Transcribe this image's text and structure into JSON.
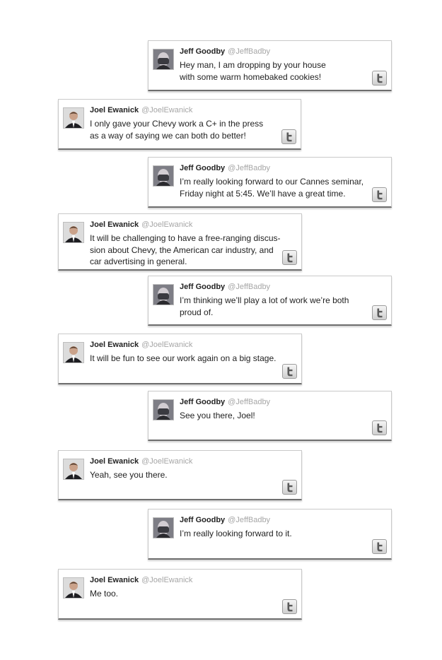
{
  "tweets": [
    {
      "side": "jeff",
      "name": "Jeff Goodby",
      "handle": "@JeffBadby",
      "text": "Hey man, I am dropping by your house\nwith some warm homebaked cookies!"
    },
    {
      "side": "joel",
      "name": "Joel Ewanick",
      "handle": "@JoelEwanick",
      "text": "I only gave your Chevy work a C+ in the press\nas a way of saying we can both do better!"
    },
    {
      "side": "jeff",
      "name": "Jeff Goodby",
      "handle": "@JeffBadby",
      "text": " I’m really looking forward to our Cannes seminar,\n Friday night at 5:45.  We’ll have a great time."
    },
    {
      "side": "joel",
      "name": "Joel Ewanick",
      "handle": "@JoelEwanick",
      "text": "It will be challenging to have a free-ranging discus-\nsion about Chevy, the American car industry, and\ncar advertising in general."
    },
    {
      "side": "jeff",
      "name": "Jeff Goodby",
      "handle": "@JeffBadby",
      "text": "I’m thinking we’ll play a lot of work we’re both\nproud of."
    },
    {
      "side": "joel",
      "name": "Joel Ewanick",
      "handle": "@JoelEwanick",
      "text": "It will be fun to see our work again on a big stage."
    },
    {
      "side": "jeff",
      "name": "Jeff Goodby",
      "handle": "@JeffBadby",
      "text": "See you there, Joel!"
    },
    {
      "side": "joel",
      "name": "Joel Ewanick",
      "handle": "@JoelEwanick",
      "text": "Yeah, see you there."
    },
    {
      "side": "jeff",
      "name": "Jeff Goodby",
      "handle": "@JeffBadby",
      "text": "I’m really looking forward to it."
    },
    {
      "side": "joel",
      "name": "Joel Ewanick",
      "handle": "@JoelEwanick",
      "text": "Me too."
    }
  ]
}
